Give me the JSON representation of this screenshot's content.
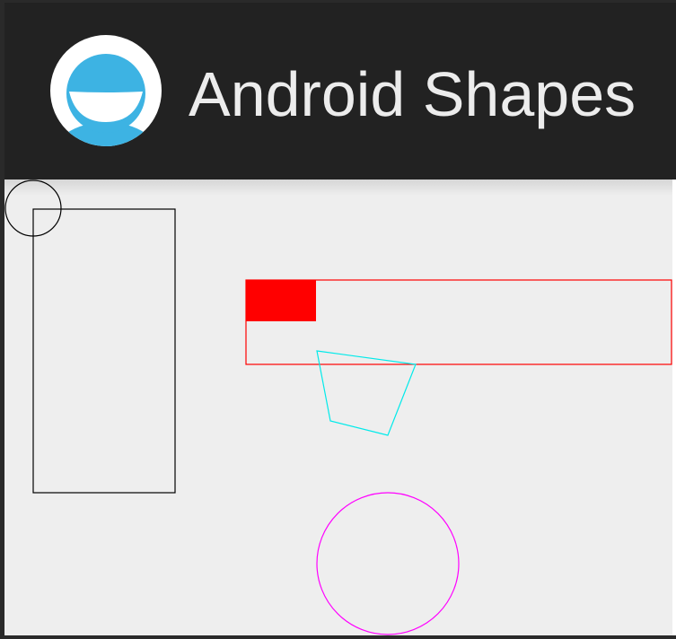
{
  "action_bar": {
    "title": "Android Shapes",
    "icon": "app-avatar-icon",
    "background": "#222222"
  },
  "canvas": {
    "background": "#eeeeee",
    "shapes": [
      {
        "name": "small-black-circle",
        "type": "circle-outline",
        "color": "#000000"
      },
      {
        "name": "black-rectangle",
        "type": "rectangle-outline",
        "color": "#000000"
      },
      {
        "name": "red-rectangle",
        "type": "rectangle-outline",
        "color": "#ff0000"
      },
      {
        "name": "red-filled-square",
        "type": "rectangle-filled",
        "color": "#ff0000"
      },
      {
        "name": "cyan-quadrilateral",
        "type": "polygon-outline",
        "color": "#00eaea"
      },
      {
        "name": "magenta-circle",
        "type": "circle-outline",
        "color": "#ff00ff"
      }
    ]
  }
}
